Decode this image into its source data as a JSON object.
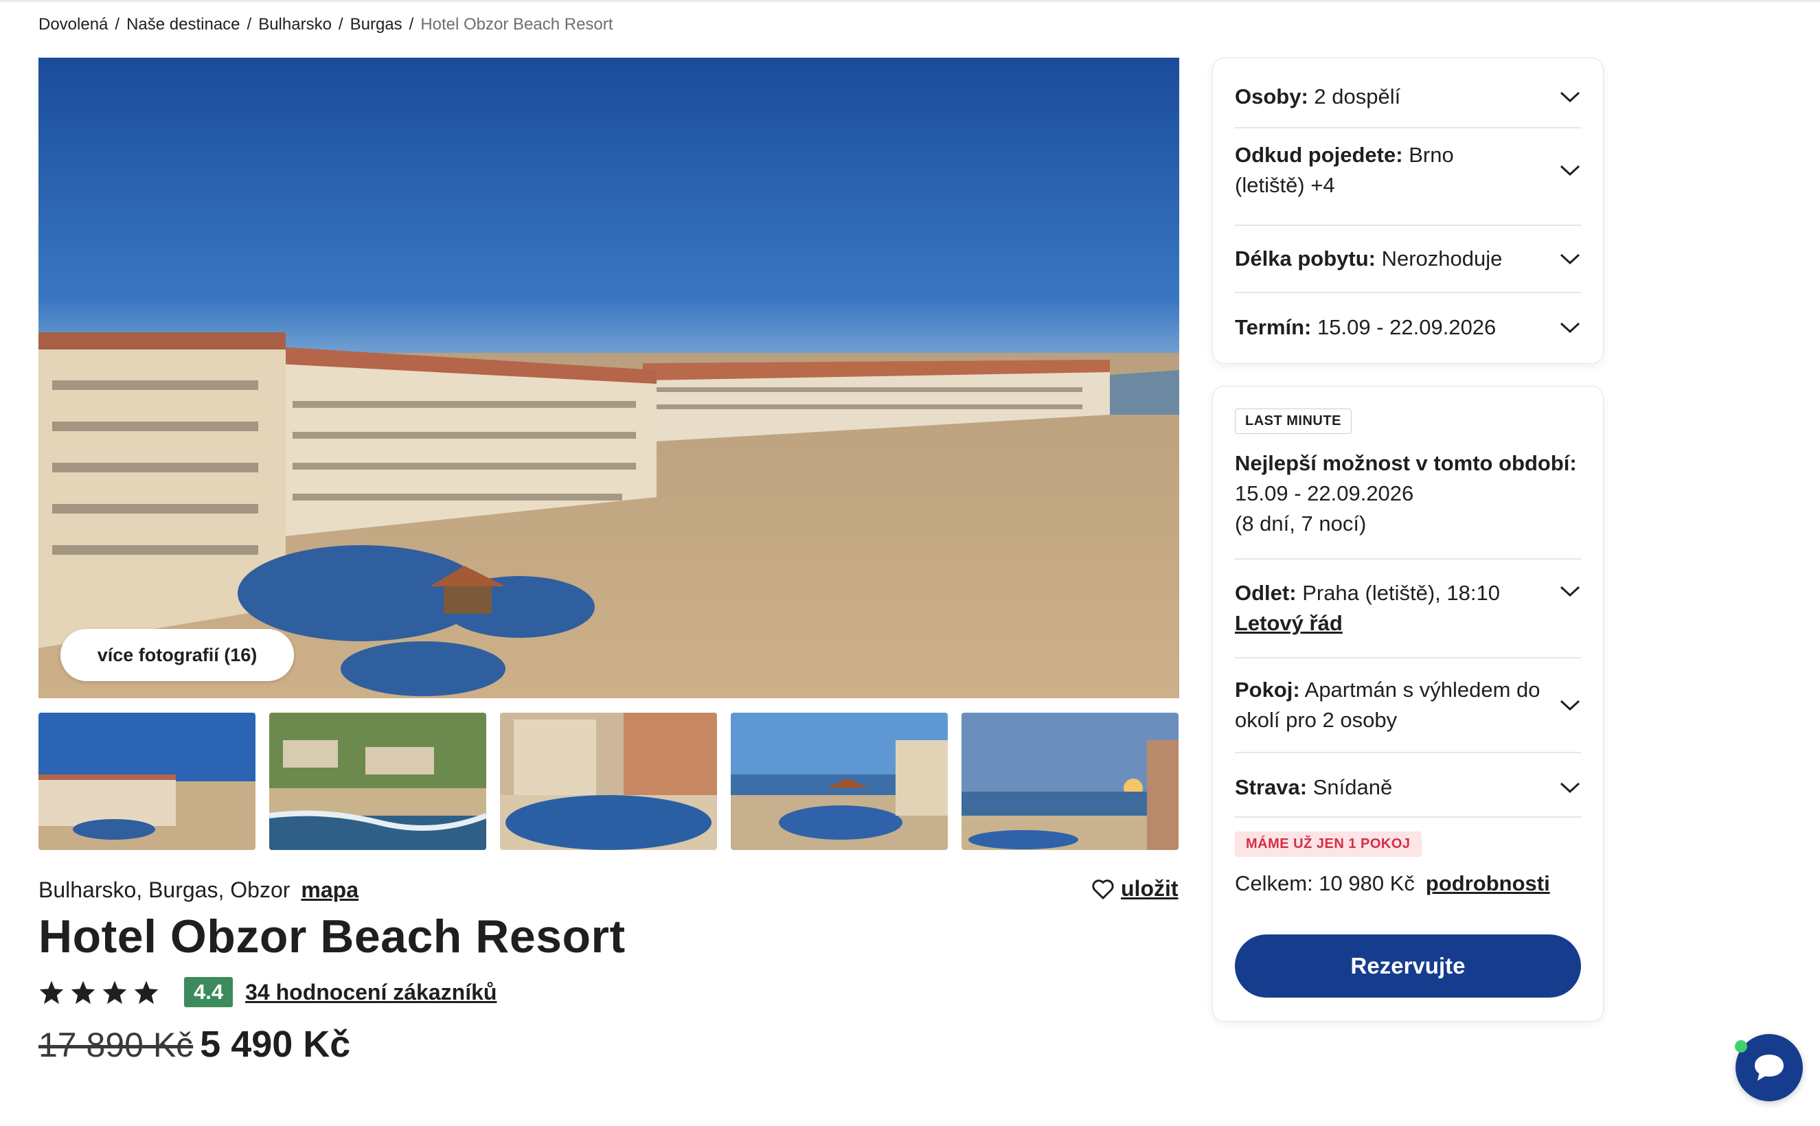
{
  "breadcrumb": [
    "Dovolená",
    "Naše destinace",
    "Bulharsko",
    "Burgas",
    "Hotel Obzor Beach Resort"
  ],
  "gallery": {
    "more_photos_label": "více fotografií (16)",
    "thumbnails": [
      "hotel-beach-aerial",
      "coastline-aerial",
      "pool-courtyard",
      "pool-sea-view",
      "sunset-sea-view"
    ]
  },
  "hotel": {
    "location": "Bulharsko, Burgas, Obzor",
    "map_link": "mapa",
    "save_label": "uložit",
    "name": "Hotel Obzor Beach Resort",
    "stars": 4,
    "rating": "4.4",
    "reviews_link": "34 hodnocení zákazníků",
    "old_price": "17 890 Kč",
    "price": "5 490 Kč"
  },
  "search_panel": {
    "persons": {
      "label": "Osoby:",
      "value": "2 dospělí"
    },
    "from": {
      "label": "Odkud pojedete:",
      "value_line1": "Brno",
      "value_line2": "(letiště) +4"
    },
    "length": {
      "label": "Délka pobytu:",
      "value": "Nerozhoduje"
    },
    "date": {
      "label": "Termín:",
      "value": "15.09 - 22.09.2026"
    }
  },
  "offer_panel": {
    "badge": "LAST MINUTE",
    "best_title": "Nejlepší možnost v tomto období:",
    "best_dates": "15.09 - 22.09.2026",
    "best_duration": "(8 dní, 7 nocí)",
    "departure": {
      "label": "Odlet:",
      "value": "Praha (letiště), 18:10",
      "schedule_link": "Letový řád"
    },
    "room": {
      "label": "Pokoj:",
      "value_line1": "Apartmán s výhledem do",
      "value_line2": "okolí pro 2 osoby"
    },
    "board": {
      "label": "Strava:",
      "value": "Snídaně"
    },
    "availability_badge": "MÁME UŽ JEN 1 POKOJ",
    "total_label": "Celkem: 10 980 Kč",
    "details_link": "podrobnosti",
    "reserve_label": "Rezervujte"
  },
  "colors": {
    "primary": "#163d8d",
    "rating_green": "#3c8b5c",
    "alert_red": "#d42f43",
    "alert_bg": "#fde4e7"
  },
  "chat": {
    "icon": "chat-bubble-icon",
    "status": "online"
  }
}
